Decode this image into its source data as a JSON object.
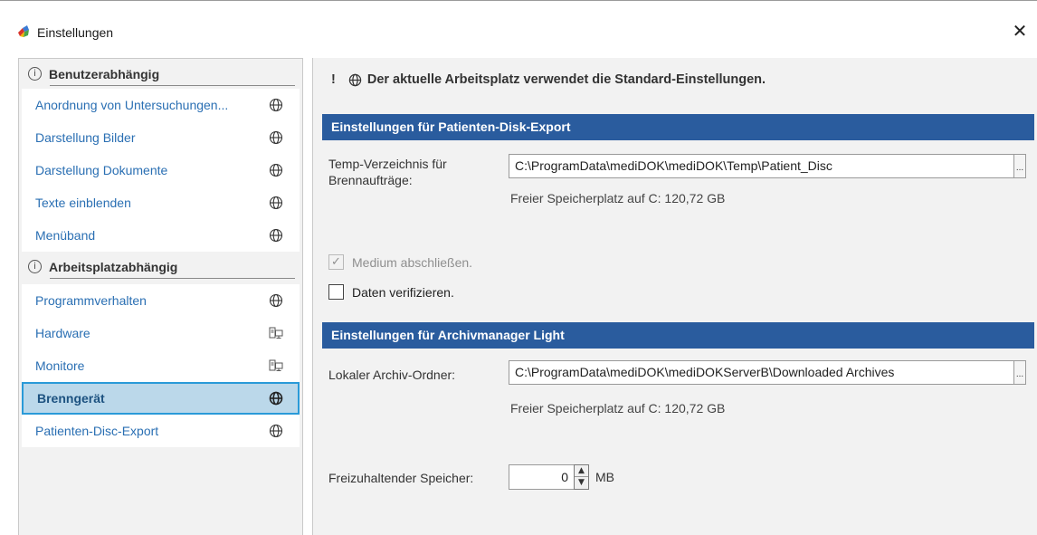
{
  "window": {
    "title": "Einstellungen",
    "close_glyph": "✕"
  },
  "sidebar": {
    "groups": [
      {
        "label": "Benutzerabhängig",
        "items": [
          {
            "label": "Anordnung von Untersuchungen...",
            "icon": "globe-icon"
          },
          {
            "label": "Darstellung Bilder",
            "icon": "globe-icon"
          },
          {
            "label": "Darstellung Dokumente",
            "icon": "globe-icon"
          },
          {
            "label": "Texte einblenden",
            "icon": "globe-icon"
          },
          {
            "label": "Menüband",
            "icon": "globe-icon"
          }
        ]
      },
      {
        "label": "Arbeitsplatzabhängig",
        "items": [
          {
            "label": "Programmverhalten",
            "icon": "globe-icon"
          },
          {
            "label": "Hardware",
            "icon": "workstation-icon"
          },
          {
            "label": "Monitore",
            "icon": "workstation-icon"
          },
          {
            "label": "Brenngerät",
            "icon": "globe-icon",
            "selected": true
          },
          {
            "label": "Patienten-Disc-Export",
            "icon": "globe-icon"
          }
        ]
      }
    ],
    "info_glyph": "i"
  },
  "main": {
    "notice": {
      "bang": "!",
      "text": "Der aktuelle Arbeitsplatz verwendet die Standard-Einstellungen."
    },
    "section1": {
      "title": "Einstellungen für Patienten-Disk-Export",
      "temp_label_line1": "Temp-Verzeichnis für",
      "temp_label_line2": "Brennaufträge:",
      "temp_path": "C:\\ProgramData\\mediDOK\\mediDOK\\Temp\\Patient_Disc",
      "browse": "...",
      "free_space": "Freier Speicherplatz auf C: 120,72 GB",
      "finalize_label": "Medium abschließen.",
      "finalize_checked": true,
      "finalize_disabled": true,
      "verify_label": "Daten verifizieren.",
      "verify_checked": false
    },
    "section2": {
      "title": "Einstellungen für Archivmanager Light",
      "archive_label": "Lokaler Archiv-Ordner:",
      "archive_path": "C:\\ProgramData\\mediDOK\\mediDOKServerB\\Downloaded Archives",
      "browse": "...",
      "free_space": "Freier Speicherplatz auf C: 120,72 GB",
      "reserve_label": "Freizuhaltender Speicher:",
      "reserve_value": "0",
      "reserve_unit": "MB"
    }
  },
  "colors": {
    "accent": "#2a5c9e",
    "nav_link": "#2a6fb3",
    "selected_bg": "#bbd8ea",
    "selected_border": "#2a9ad8",
    "panel_bg": "#f2f2f2"
  }
}
